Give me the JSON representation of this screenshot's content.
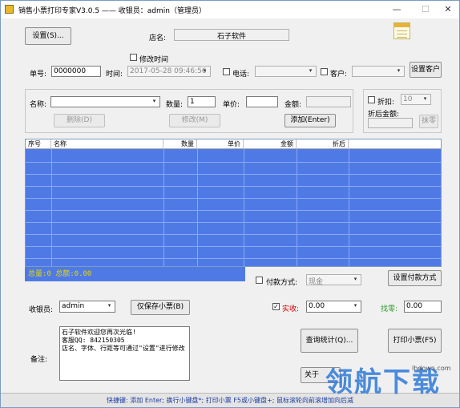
{
  "window": {
    "title": "销售小票打印专家V3.0.5 —— 收银员：admin（管理员）",
    "min": "—",
    "max": "☐",
    "close": "✕"
  },
  "top": {
    "settings_button": "设置(S)...",
    "store_label": "店名:",
    "store_name": "石子软件",
    "modify_time_label": "修改时间",
    "order_no_label": "单号:",
    "order_no": "0000000",
    "time_label": "时间:",
    "time_value": "2017-05-28 09:46:56",
    "phone_label": "电话:",
    "customer_label": "客户:",
    "set_customer_button": "设置客户"
  },
  "item": {
    "name_label": "名称:",
    "qty_label": "数量:",
    "qty": "1",
    "price_label": "单价:",
    "amount_label": "金额:",
    "delete_button": "删除(D)",
    "modify_button": "修改(M)",
    "add_button": "添加(Enter)",
    "discount_label": "折扣:",
    "discount_value": "10",
    "after_discount_label": "折后金额:",
    "round_button": "抹零"
  },
  "grid": {
    "columns": [
      "序号",
      "名称",
      "数量",
      "单价",
      "金额",
      "折后"
    ],
    "rows": []
  },
  "summary": {
    "text": "总量:0  总额:0.00"
  },
  "payment": {
    "method_label": "付款方式:",
    "method_value": "现金",
    "set_method_button": "设置付款方式",
    "cashier_label": "收银员:",
    "cashier_value": "admin",
    "save_only_button": "仅保存小票(B)",
    "paid_label": "实收:",
    "paid_value": "0.00",
    "change_label": "找零:",
    "change_value": "0.00"
  },
  "notes": {
    "label": "备注:",
    "text": "石子软件欢迎您再次光临!\n客服QQ: 842150305\n店名、字体、行距等可通过\"设置\"进行修改"
  },
  "actions": {
    "query_button": "查询统计(Q)...",
    "print_button": "打印小票(F5)",
    "about_button": "关于"
  },
  "status": {
    "text": "快捷键: 添加 Enter; 换行小键盘*; 打印小票 F5或小键盘+; 鼠标滚轮向前滚增加向后减"
  },
  "watermark": {
    "text": "领航下载",
    "url": "lhdown.com"
  },
  "colors": {
    "grid_blue": "#4f7ae6",
    "summary_yellow": "#e6d700",
    "paid_red": "#d40000",
    "change_green": "#2a9a2a"
  }
}
